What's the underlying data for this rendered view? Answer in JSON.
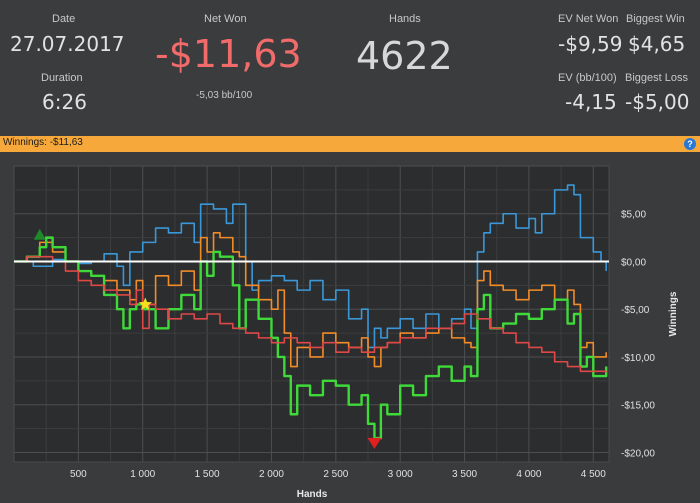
{
  "summary": {
    "date_label": "Date",
    "date_value": "27.07.2017",
    "duration_label": "Duration",
    "duration_value": "6:26",
    "net_won_label": "Net Won",
    "net_won_value": "-$11,63",
    "net_won_bb": "-5,03 bb/100",
    "hands_label": "Hands",
    "hands_value": "4622",
    "ev_net_won_label": "EV Net Won",
    "ev_net_won_value": "-$9,59",
    "biggest_win_label": "Biggest Win",
    "biggest_win_value": "$4,65",
    "ev_bb_label": "EV (bb/100)",
    "ev_bb_value": "-4,15",
    "biggest_loss_label": "Biggest Loss",
    "biggest_loss_value": "-$5,00"
  },
  "header_bar": {
    "label": "Winnings:",
    "value": "-$11,63",
    "help_glyph": "?"
  },
  "colors": {
    "net_won": "#f26b6b",
    "header_bar": "#f7a83a",
    "green": "#3fd93a",
    "orange": "#f28c28",
    "red": "#e04848",
    "blue": "#3a98d8",
    "white": "#ffffff"
  },
  "chart_data": {
    "type": "line",
    "xlabel": "Hands",
    "ylabel": "Winnings",
    "xlim": [
      0,
      4622
    ],
    "ylim": [
      -21,
      10
    ],
    "x_ticks": [
      500,
      1000,
      1500,
      2000,
      2500,
      3000,
      3500,
      4000,
      4500
    ],
    "x_tick_labels": [
      "500",
      "1 000",
      "1 500",
      "2 000",
      "2 500",
      "3 000",
      "3 500",
      "4 000",
      "4 500"
    ],
    "y_ticks": [
      5,
      0,
      -5,
      -10,
      -15,
      -20
    ],
    "y_tick_labels": [
      "$5,00",
      "$0,00",
      "-$5,00",
      "-$10,00",
      "-$15,00",
      "-$20,00"
    ],
    "grid": true,
    "zero_line": true,
    "series": [
      {
        "color": "#3a98d8",
        "x": [
          0,
          150,
          300,
          400,
          500,
          600,
          700,
          800,
          850,
          900,
          1000,
          1100,
          1200,
          1300,
          1400,
          1450,
          1550,
          1650,
          1700,
          1800,
          1850,
          1900,
          2000,
          2100,
          2200,
          2300,
          2400,
          2500,
          2600,
          2700,
          2750,
          2800,
          2850,
          2900,
          3000,
          3100,
          3200,
          3300,
          3400,
          3500,
          3550,
          3600,
          3650,
          3700,
          3800,
          3900,
          4000,
          4050,
          4100,
          4200,
          4300,
          4350,
          4400,
          4500,
          4560,
          4600
        ],
        "y": [
          0,
          -0.5,
          0.2,
          0,
          -0.2,
          0,
          0.8,
          -0.5,
          -2.5,
          1,
          2,
          3.5,
          3,
          4,
          2,
          6,
          5.5,
          4,
          6,
          0,
          -3,
          -2,
          -1.5,
          -2,
          -3,
          -2,
          -4,
          -3,
          -6,
          -5,
          -9,
          -7,
          -8,
          -7,
          -6,
          -7,
          -5.5,
          -7,
          -6,
          -5,
          -7,
          1,
          3,
          4,
          5,
          3.5,
          4.5,
          3,
          5,
          7.5,
          8,
          7,
          2.5,
          1,
          0,
          -1
        ]
      },
      {
        "color": "#f28c28",
        "x": [
          0,
          100,
          200,
          300,
          400,
          500,
          600,
          700,
          800,
          900,
          950,
          1000,
          1100,
          1200,
          1300,
          1400,
          1450,
          1500,
          1550,
          1600,
          1700,
          1750,
          1800,
          1900,
          2000,
          2050,
          2100,
          2150,
          2200,
          2300,
          2400,
          2500,
          2600,
          2700,
          2750,
          2800,
          2850,
          2900,
          3000,
          3100,
          3200,
          3300,
          3400,
          3500,
          3550,
          3600,
          3650,
          3700,
          3800,
          3900,
          4000,
          4100,
          4200,
          4300,
          4350,
          4400,
          4450,
          4500,
          4600
        ],
        "y": [
          0,
          0.5,
          2,
          1,
          0,
          -1,
          -1.5,
          -2,
          -3,
          -4,
          -2,
          -4.5,
          -1.5,
          -2.5,
          -1,
          -3,
          2.5,
          1,
          3,
          2.5,
          1,
          0.5,
          -2.5,
          -4,
          -5,
          -3,
          -7.5,
          -11,
          -9,
          -10,
          -7.5,
          -8.5,
          -9,
          -8,
          -10,
          -11,
          -9,
          -8.5,
          -7.5,
          -8,
          -7.5,
          -7,
          -8,
          -8.5,
          -9,
          -2,
          -1,
          -2.5,
          -3,
          -4,
          -3,
          -2.5,
          -4,
          -3,
          -4.5,
          -9,
          -8.5,
          -10,
          -9.5
        ]
      },
      {
        "color": "#3fd93a",
        "x": [
          0,
          100,
          200,
          250,
          300,
          400,
          500,
          600,
          700,
          800,
          850,
          900,
          950,
          1000,
          1100,
          1200,
          1300,
          1400,
          1450,
          1500,
          1550,
          1600,
          1700,
          1750,
          1800,
          1900,
          2000,
          2050,
          2100,
          2150,
          2200,
          2300,
          2400,
          2500,
          2600,
          2700,
          2750,
          2800,
          2850,
          2900,
          3000,
          3100,
          3200,
          3300,
          3400,
          3500,
          3550,
          3600,
          3650,
          3700,
          3800,
          3900,
          4000,
          4100,
          4200,
          4300,
          4350,
          4400,
          4450,
          4500,
          4600
        ],
        "y": [
          0,
          0.5,
          1.5,
          2.5,
          1.5,
          0,
          -1,
          -1.5,
          -3.5,
          -5,
          -7,
          -5,
          -4.5,
          -5,
          -7,
          -5,
          -3.5,
          -5,
          0,
          -1.5,
          1,
          0.5,
          -2.5,
          -7,
          -4,
          -6,
          -8,
          -10,
          -12,
          -16,
          -13,
          -14,
          -12.5,
          -13,
          -15,
          -14,
          -17,
          -18.5,
          -15,
          -16,
          -13,
          -14,
          -12,
          -11,
          -12.5,
          -11,
          -12,
          -5,
          -3.5,
          -7,
          -6.5,
          -5.5,
          -6,
          -5,
          -4,
          -6.5,
          -5.5,
          -11,
          -10,
          -12,
          -11
        ]
      },
      {
        "color": "#e04848",
        "x": [
          0,
          100,
          200,
          300,
          400,
          500,
          600,
          700,
          800,
          900,
          950,
          1000,
          1050,
          1100,
          1200,
          1300,
          1400,
          1500,
          1600,
          1700,
          1800,
          1900,
          2000,
          2100,
          2200,
          2300,
          2400,
          2500,
          2600,
          2700,
          2800,
          2900,
          3000,
          3100,
          3200,
          3300,
          3400,
          3500,
          3600,
          3700,
          3800,
          3900,
          4000,
          4100,
          4200,
          4300,
          4400,
          4500,
          4600
        ],
        "y": [
          0,
          0.5,
          0.5,
          0,
          -1,
          -2,
          -2.5,
          -3,
          -3.5,
          -4.5,
          -3,
          -7,
          -4.5,
          -5,
          -6,
          -5.5,
          -6,
          -5.5,
          -6.5,
          -7,
          -7.5,
          -8,
          -8.5,
          -8,
          -8.5,
          -9,
          -8.5,
          -9.5,
          -9,
          -9.5,
          -9,
          -8.5,
          -8,
          -8,
          -7,
          -7,
          -6.5,
          -5.5,
          -6,
          -7,
          -7.5,
          -8.5,
          -9,
          -9.5,
          -10.5,
          -11,
          -11.5,
          -11.5,
          -11.6
        ]
      }
    ],
    "markers": [
      {
        "name": "max-marker",
        "shape": "triangle-up",
        "color": "#1e8a2a",
        "x": 200,
        "y": 2.8
      },
      {
        "name": "min-marker",
        "shape": "triangle-down",
        "color": "#e02020",
        "x": 2800,
        "y": -19
      },
      {
        "name": "star-marker",
        "shape": "star",
        "color": "#f4e020",
        "x": 1020,
        "y": -4.5
      }
    ]
  }
}
